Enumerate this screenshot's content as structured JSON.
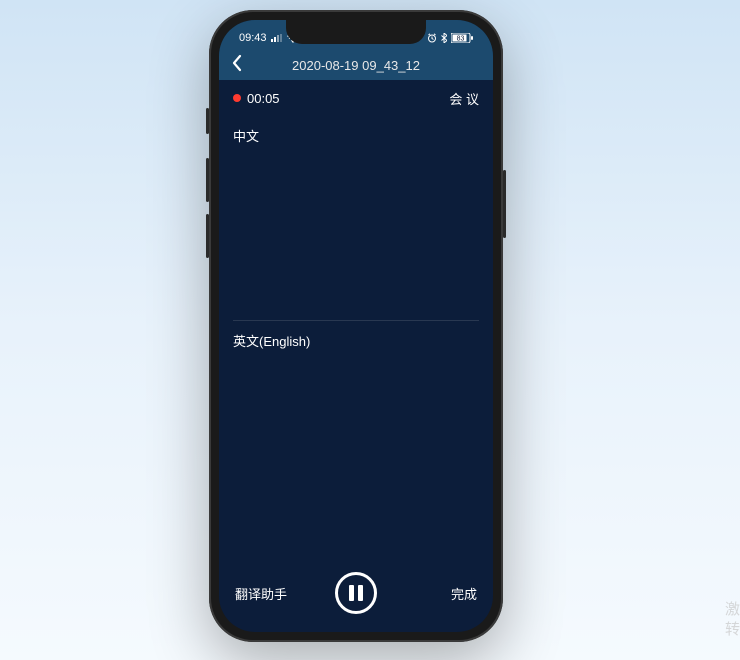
{
  "status": {
    "time": "09:43",
    "battery_pct": "83"
  },
  "header": {
    "title": "2020-08-19 09_43_12"
  },
  "recording": {
    "elapsed": "00:05",
    "type_label": "会 议"
  },
  "sections": {
    "top_lang": "中文",
    "bottom_lang": "英文(English)"
  },
  "bottom": {
    "left_label": "翻译助手",
    "right_label": "完成"
  },
  "watermark": {
    "line1": "激",
    "line2": "转"
  }
}
